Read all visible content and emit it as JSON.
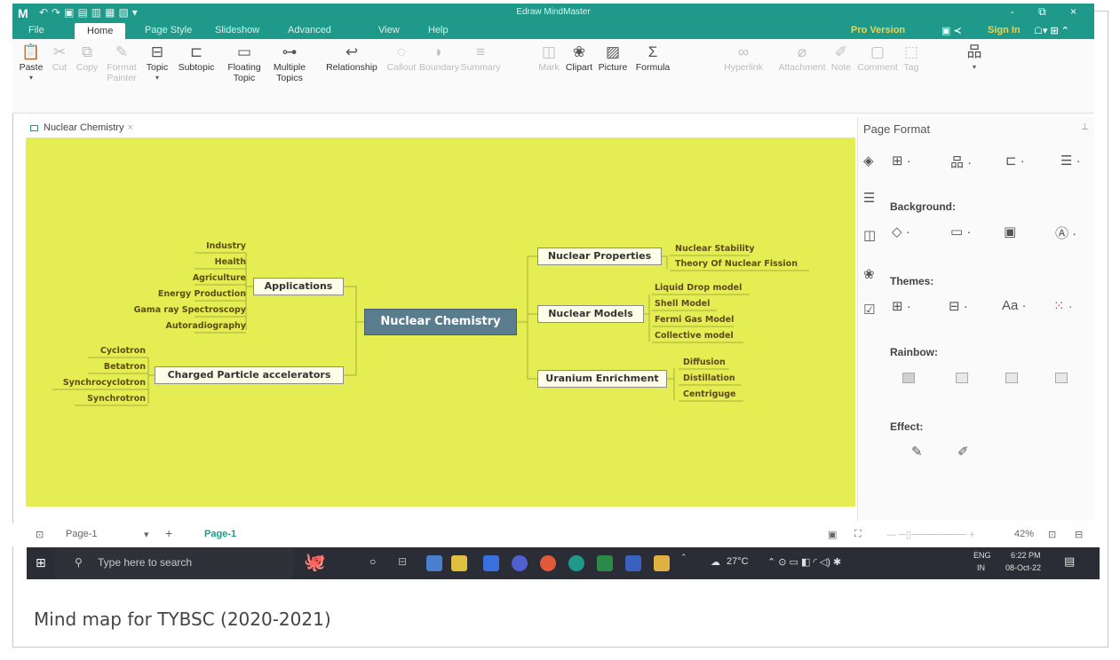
{
  "window": {
    "title": "Edraw MindMaster",
    "controls": [
      "-",
      "⧉",
      "×"
    ]
  },
  "menu": {
    "tabs": [
      "File",
      "Home",
      "Page Style",
      "Slideshow",
      "Advanced",
      "View",
      "Help"
    ],
    "active_tab": "Home",
    "pro_version": "Pro Version",
    "sign_in": "Sign In"
  },
  "ribbon": {
    "paste": "Paste",
    "cut": "Cut",
    "copy": "Copy",
    "format_painter_1": "Format",
    "format_painter_2": "Painter",
    "topic": "Topic",
    "subtopic": "Subtopic",
    "floating_1": "Floating",
    "floating_2": "Topic",
    "multiple_1": "Multiple",
    "multiple_2": "Topics",
    "relationship": "Relationship",
    "callout": "Callout",
    "boundary": "Boundary",
    "summary": "Summary",
    "mark": "Mark",
    "clipart": "Clipart",
    "picture": "Picture",
    "formula": "Formula",
    "hyperlink": "Hyperlink",
    "attachment": "Attachment",
    "note": "Note",
    "comment": "Comment",
    "tag": "Tag"
  },
  "document": {
    "tab_title": "Nuclear Chemistry"
  },
  "mindmap": {
    "central": "Nuclear Chemistry",
    "applications": {
      "label": "Applications",
      "children": [
        "Industry",
        "Health",
        "Agriculture",
        "Energy Production",
        "Gama ray Spectroscopy",
        "Autoradiography"
      ]
    },
    "accelerators": {
      "label": "Charged Particle accelerators",
      "children": [
        "Cyclotron",
        "Betatron",
        "Synchrocyclotron",
        "Synchrotron"
      ]
    },
    "properties": {
      "label": "Nuclear Properties",
      "children": [
        "Nuclear Stability",
        "Theory Of Nuclear Fission"
      ]
    },
    "models": {
      "label": "Nuclear Models",
      "children": [
        "Liquid Drop model",
        "Shell Model",
        "Fermi Gas Model",
        "Collective model"
      ]
    },
    "enrichment": {
      "label": "Uranium Enrichment",
      "children": [
        "Diffusion",
        "Distillation",
        "Centriguge"
      ]
    }
  },
  "panel": {
    "title": "Page Format",
    "background": "Background:",
    "themes": "Themes:",
    "theme_font": "Aa",
    "rainbow": "Rainbow:",
    "effect": "Effect:"
  },
  "status": {
    "page_selector": "Page-1",
    "add": "+",
    "active_page": "Page-1",
    "zoom": "42%"
  },
  "taskbar": {
    "search_placeholder": "Type here to search",
    "weather": "27°C",
    "lang_1": "ENG",
    "lang_2": "IN",
    "time": "6:22 PM",
    "date": "08-Oct-22"
  },
  "caption": "Mind map for TYBSC (2020-2021)",
  "colors": {
    "accent": "#1f9a8a",
    "canvas": "#e4ee52",
    "central": "#5a7d8e"
  }
}
